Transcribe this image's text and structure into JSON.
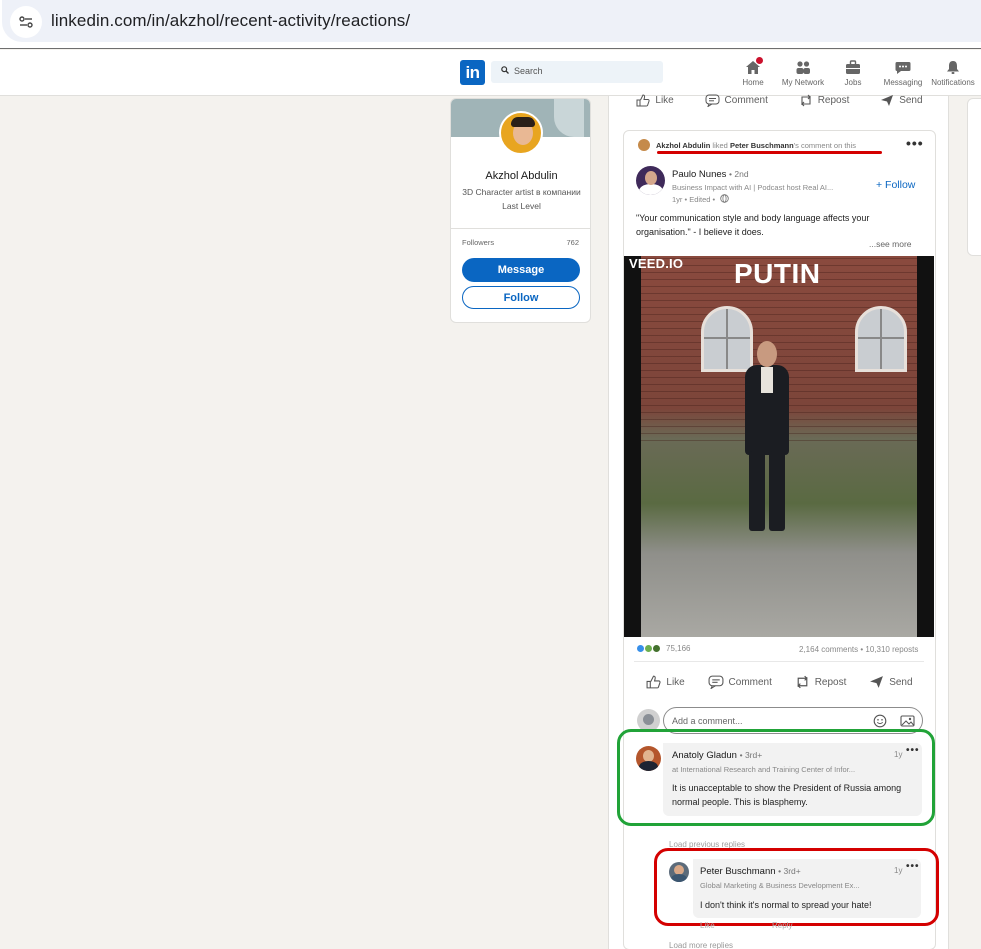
{
  "browser": {
    "url": "linkedin.com/in/akzhol/recent-activity/reactions/"
  },
  "nav": {
    "logo": "in",
    "search_placeholder": "Search",
    "items": [
      {
        "label": "Home",
        "icon": "home-icon"
      },
      {
        "label": "My Network",
        "icon": "network-icon"
      },
      {
        "label": "Jobs",
        "icon": "briefcase-icon"
      },
      {
        "label": "Messaging",
        "icon": "message-icon"
      },
      {
        "label": "Notifications",
        "icon": "bell-icon"
      }
    ]
  },
  "profile": {
    "name": "Akzhol Abdulin",
    "headline": "3D Character artist в компании Last Level",
    "followers_label": "Followers",
    "followers_count": "762",
    "message_label": "Message",
    "follow_label": "Follow"
  },
  "top_actions": {
    "like": "Like",
    "comment": "Comment",
    "repost": "Repost",
    "send": "Send"
  },
  "post": {
    "activity": {
      "actor": "Akzhol Abdulin",
      "verb": "liked",
      "target": "Peter Buschmann",
      "suffix": "'s comment on this"
    },
    "author": {
      "name": "Paulo Nunes",
      "degree": "• 2nd",
      "headline": "Business Impact with AI | Podcast host Real AI...",
      "meta": "1yr • Edited •",
      "follow_label": "+ Follow"
    },
    "text": "\"Your communication style and body language affects your organisation.\" - I believe it does.",
    "see_more": "...see more",
    "video": {
      "watermark": "VEED.IO",
      "caption": "PUTIN"
    },
    "reactions_count": "75,166",
    "comments_reposts": "2,164 comments • 10,310 reposts",
    "actions": {
      "like": "Like",
      "comment": "Comment",
      "repost": "Repost",
      "send": "Send"
    },
    "comment_placeholder": "Add a comment..."
  },
  "comments": [
    {
      "name": "Anatoly Gladun",
      "degree": "• 3rd+",
      "headline": "at International Research and Training Center of Infor...",
      "time": "1y",
      "text": "It is unacceptable to show the President of Russia among normal people. This is blasphemy."
    }
  ],
  "load_previous": "Load previous replies",
  "replies": [
    {
      "name": "Peter Buschmann",
      "degree": "• 3rd+",
      "headline": "Global Marketing & Business Development Ex...",
      "time": "1y",
      "text": "I don't think it's normal to spread your hate!",
      "like_label": "Like",
      "reply_label": "Reply"
    }
  ],
  "load_more": "Load more replies",
  "colors": {
    "linkedin_blue": "#0a66c2",
    "highlight_green": "#21a338",
    "highlight_red": "#d40000"
  }
}
